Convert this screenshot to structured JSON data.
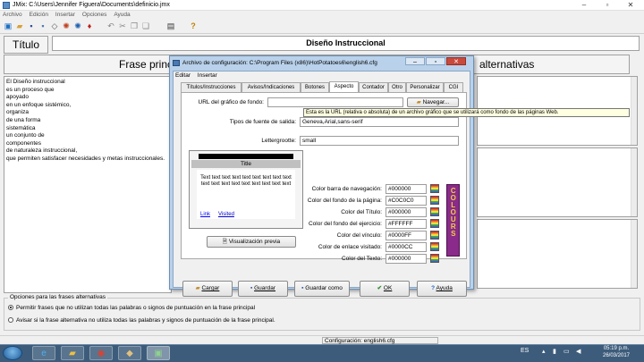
{
  "app": {
    "title": "JMix: C:\\Users\\Jennifer Figuera\\Documents\\definicio.jmx"
  },
  "menu": [
    "Archivo",
    "Edición",
    "Insertar",
    "Opciones",
    "Ayuda"
  ],
  "title_section": {
    "button": "Título",
    "value": "Diseño Instruccional"
  },
  "frase": {
    "left": "Frase principal",
    "right": "alternativas"
  },
  "main_lines": [
    "El Diseño instruccional",
    "es un proceso que",
    "apoyado",
    "en un enfoque sistémico,",
    "organiza",
    "de una forma",
    "sistemática",
    "un conjunto de",
    "componentes",
    "de naturaleza instruccional,",
    "que permiten satisfacer necesidades y metas instruccionales."
  ],
  "options": {
    "legend": "Opciones para las frases alternativas",
    "opt1": "Permitir frases que no utilizan todas las palabras o signos de puntuación en la frase principal",
    "opt2": "Avisar si la frase alternativa no utiliza todas las palabras y signos de puntuación de la frase principal."
  },
  "status": "Configuración: english6.cfg",
  "dialog": {
    "title": "Archivo de configuración: C:\\Program Files (x86)\\HotPotatoes6\\english6.cfg",
    "menu": [
      "Editar",
      "Insertar"
    ],
    "tabs": [
      "Títulos/Instrucciones",
      "Avisos/Indicaciones",
      "Botones",
      "Aspecto",
      "Contador",
      "Otro",
      "Personalizar",
      "CGI"
    ],
    "active_tab": "Aspecto",
    "url_label": "URL del gráfico de fondo:",
    "url_value": "",
    "browse": "Navegar...",
    "tooltip": "Esta es la URL (relativa o absoluta) de un archivo gráfico que se utilizará como fondo de las páginas Web.",
    "font_label": "Tipos de fuente de salida:",
    "font_value": "Geneva,Arial,sans-serif",
    "size_label": "Lettergrootte:",
    "size_value": "small",
    "preview": {
      "title": "Title",
      "text": "Text text text text text text text text text text text text text text text text text text",
      "link": "Link",
      "visited": "Visited",
      "button": "Visualización previa"
    },
    "colors": [
      {
        "label": "Color barra de navegación:",
        "value": "#000000"
      },
      {
        "label": "Color del fondo de la página:",
        "value": "#C0C0C0"
      },
      {
        "label": "Color del Título:",
        "value": "#000000"
      },
      {
        "label": "Color del fondo del ejercicio:",
        "value": "#FFFFFF"
      },
      {
        "label": "Color del vínculo:",
        "value": "#0000FF"
      },
      {
        "label": "Color de enlace visitado:",
        "value": "#0000CC"
      },
      {
        "label": "Color del Texto:",
        "value": "#000000"
      }
    ],
    "colours_badge": "COLOURS",
    "buttons": {
      "load": "Cargar",
      "save": "Guardar",
      "saveas": "Guardar como",
      "ok": "OK",
      "help": "Ayuda"
    }
  },
  "taskbar": {
    "lang": "ES",
    "time": "05:19 p.m.",
    "date": "26/03/2017"
  }
}
